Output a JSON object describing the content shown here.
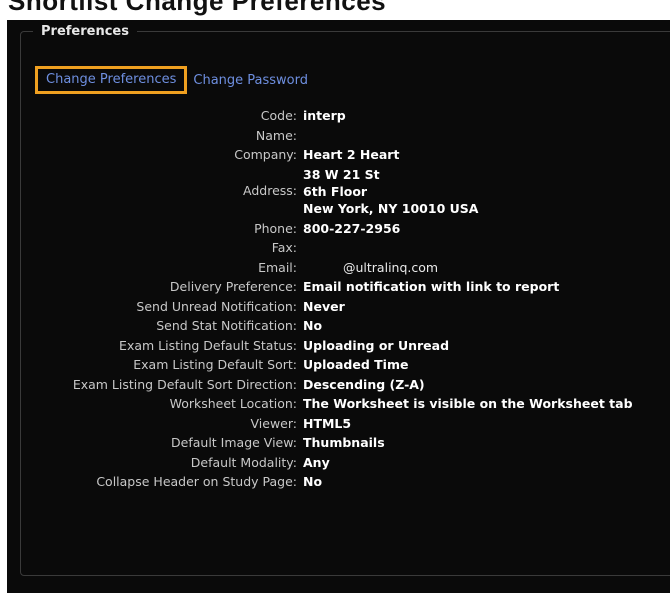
{
  "page": {
    "heading": "Shortlist Change Preferences"
  },
  "section": {
    "legend": "Preferences"
  },
  "tabs": {
    "change_preferences": "Change Preferences",
    "change_password": "Change Password"
  },
  "fields": [
    {
      "label": "Code:",
      "value": "interp"
    },
    {
      "label": "Name:",
      "value": ""
    },
    {
      "label": "Company:",
      "value": "Heart 2 Heart"
    },
    {
      "label": "Address:",
      "lines": [
        "38 W 21 St",
        "6th Floor",
        "New York, NY 10010 USA"
      ]
    },
    {
      "label": "Phone:",
      "value": "800-227-2956"
    },
    {
      "label": "Fax:",
      "value": ""
    },
    {
      "label": "Email:",
      "value": "@ultralinq.com"
    },
    {
      "label": "Delivery Preference:",
      "value": "Email notification with link to report"
    },
    {
      "label": "Send Unread Notification:",
      "value": "Never"
    },
    {
      "label": "Send Stat Notification:",
      "value": "No"
    },
    {
      "label": "Exam Listing Default Status:",
      "value": "Uploading or Unread"
    },
    {
      "label": "Exam Listing Default Sort:",
      "value": "Uploaded Time"
    },
    {
      "label": "Exam Listing Default Sort Direction:",
      "value": "Descending (Z-A)"
    },
    {
      "label": "Worksheet Location:",
      "value": "The Worksheet is visible on the Worksheet tab"
    },
    {
      "label": "Viewer:",
      "value": "HTML5"
    },
    {
      "label": "Default Image View:",
      "value": "Thumbnails"
    },
    {
      "label": "Default Modality:",
      "value": "Any"
    },
    {
      "label": "Collapse Header on Study Page:",
      "value": "No"
    }
  ],
  "colors": {
    "panel_bg": "#0a0a0a",
    "link": "#6e8fe0",
    "active_tab_border": "#f0a020",
    "label": "#c8c8c8",
    "value": "#ffffff"
  }
}
